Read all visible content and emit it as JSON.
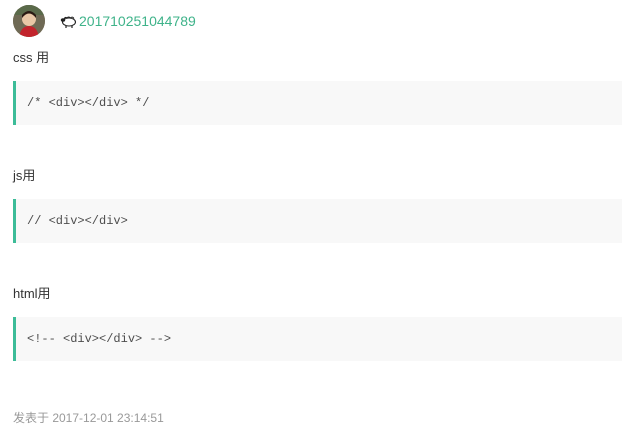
{
  "user": {
    "name": "201710251044789",
    "avatar_icon": "user-avatar-photo",
    "badge_icon": "sheep-icon",
    "link_color": "#3fb38a"
  },
  "sections": [
    {
      "label": "css 用",
      "code": "/* <div></div> */"
    },
    {
      "label": "js用",
      "code": "// <div></div>"
    },
    {
      "label": "html用",
      "code": "<!-- <div></div> -->"
    }
  ],
  "footer": {
    "posted_label": "发表于 2017-12-01 23:14:51"
  },
  "colors": {
    "code_border": "#3cbc98",
    "code_background": "#f8f8f8",
    "meta_text": "#999999"
  }
}
